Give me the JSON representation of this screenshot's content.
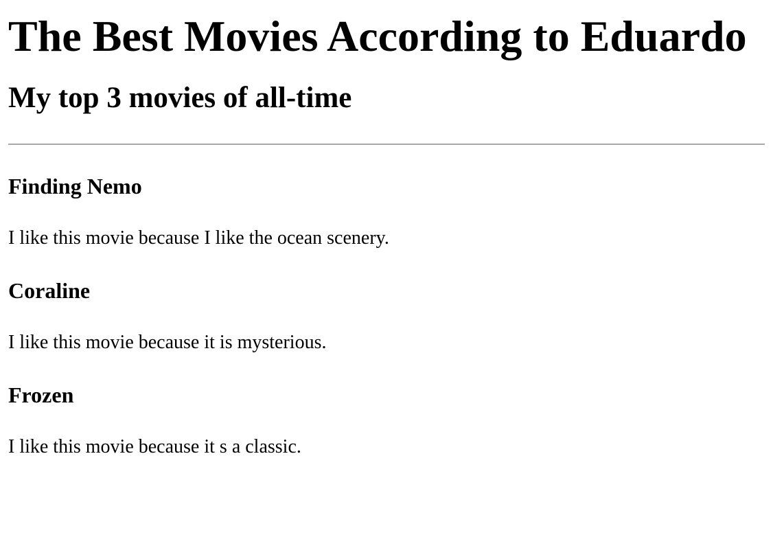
{
  "page": {
    "title": "The Best Movies According to Eduardo",
    "subtitle": "My top 3 movies of all-time"
  },
  "movies": [
    {
      "title": "Finding Nemo",
      "reason": "I like this movie because I like the ocean scenery."
    },
    {
      "title": "Coraline",
      "reason": "I like this movie because it is mysterious."
    },
    {
      "title": "Frozen",
      "reason": "I like this movie because it s a classic."
    }
  ],
  "colors": {
    "text": "#000000",
    "background": "#ffffff",
    "divider": "#a9a9a9"
  }
}
